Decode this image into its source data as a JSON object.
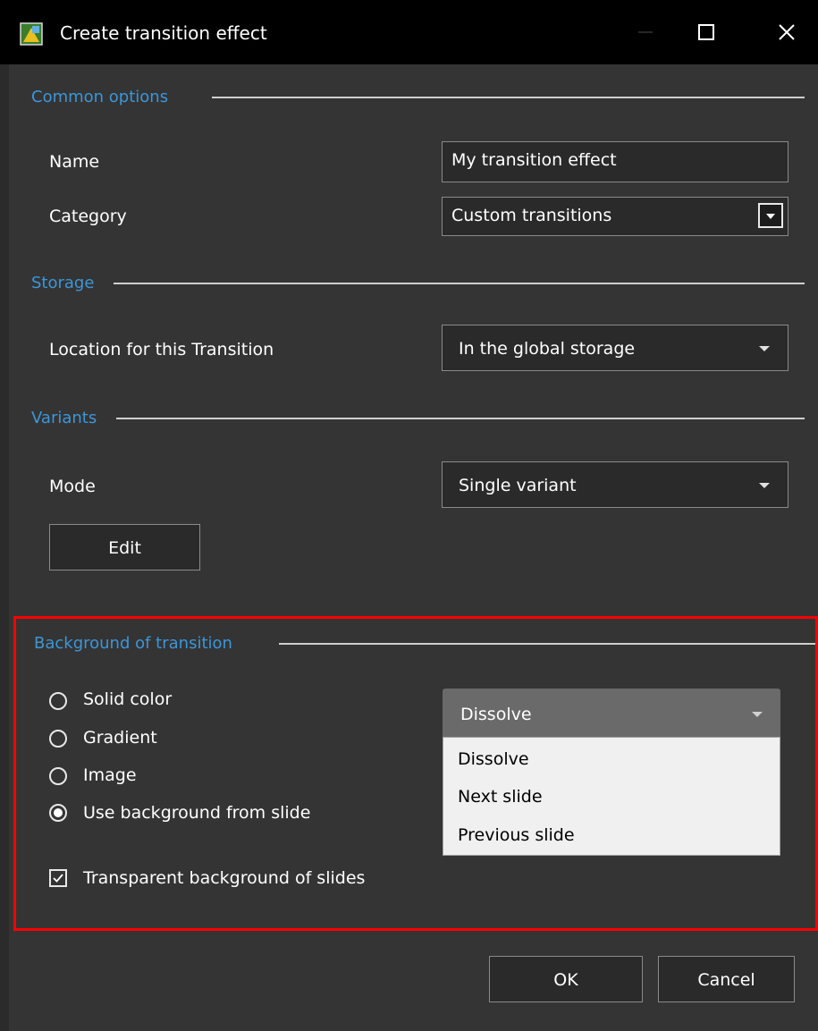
{
  "window": {
    "title": "Create transition effect",
    "icons": [
      "app-icon",
      "minimize-icon",
      "maximize-icon",
      "close-icon"
    ]
  },
  "common_options": {
    "heading": "Common options",
    "name_label": "Name",
    "name_value": "My transition effect",
    "category_label": "Category",
    "category_value": "Custom transitions"
  },
  "storage": {
    "heading": "Storage",
    "location_label": "Location for this Transition",
    "location_value": "In the global storage"
  },
  "variants": {
    "heading": "Variants",
    "mode_label": "Mode",
    "mode_value": "Single variant",
    "edit_label": "Edit"
  },
  "background": {
    "heading": "Background of transition",
    "radios": [
      {
        "label": "Solid color",
        "checked": false
      },
      {
        "label": "Gradient",
        "checked": false
      },
      {
        "label": "Image",
        "checked": false
      },
      {
        "label": "Use background from slide",
        "checked": true
      }
    ],
    "transparent_label": "Transparent background of slides",
    "transparent_checked": true,
    "dropdown": {
      "selected": "Dissolve",
      "options": [
        "Dissolve",
        "Next slide",
        "Previous slide"
      ]
    },
    "highlight_color": "#ff0000"
  },
  "footer": {
    "ok_label": "OK",
    "cancel_label": "Cancel"
  },
  "colors": {
    "accent": "#3c96d8",
    "titlebar": "#000000",
    "panel": "#343434"
  }
}
